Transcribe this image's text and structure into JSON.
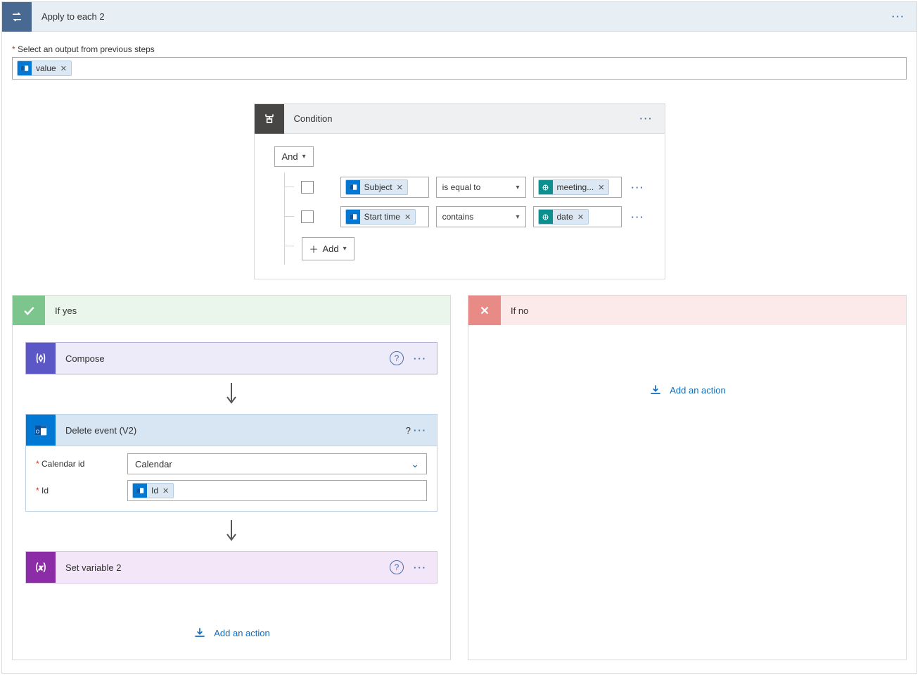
{
  "header": {
    "title": "Apply to each 2"
  },
  "output_section": {
    "label": "Select an output from previous steps",
    "token": "value"
  },
  "condition": {
    "title": "Condition",
    "group_op": "And",
    "rows": [
      {
        "left_token": "Subject",
        "operator": "is equal to",
        "right_token": "meeting...",
        "right_source": "teal"
      },
      {
        "left_token": "Start time",
        "operator": "contains",
        "right_token": "date",
        "right_source": "teal"
      }
    ],
    "add_label": "Add"
  },
  "branches": {
    "yes": {
      "title": "If yes",
      "compose": {
        "title": "Compose"
      },
      "delete_event": {
        "title": "Delete event (V2)",
        "fields": {
          "calendar_label": "Calendar id",
          "calendar_value": "Calendar",
          "id_label": "Id",
          "id_token": "Id"
        }
      },
      "set_variable": {
        "title": "Set variable 2"
      },
      "add_action": "Add an action"
    },
    "no": {
      "title": "If no",
      "add_action": "Add an action"
    }
  }
}
